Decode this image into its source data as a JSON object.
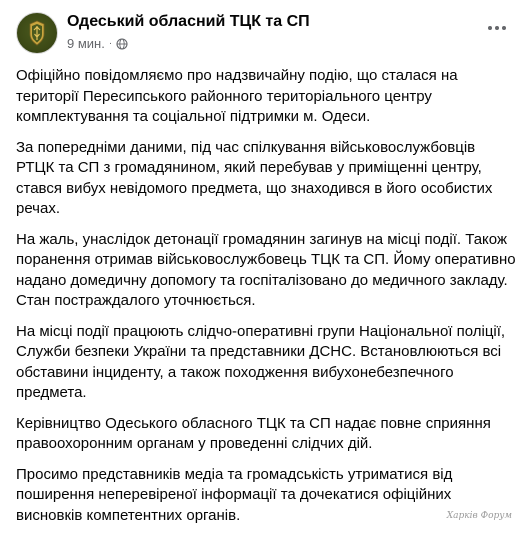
{
  "post": {
    "author": "Одеський обласний ТЦК та СП",
    "time": "9 мин.",
    "separator": "·",
    "audience_icon": "globe-icon",
    "more_icon": "more-horizontal-icon",
    "paragraphs": [
      "Офіційно повідомляємо про надзвичайну подію, що сталася на території Пересипського районного територіального центру комплектування та соціальної підтримки м. Одеси.",
      "За попередніми даними, під час спілкування військовослужбовців РТЦК та СП з громадянином, який перебував у приміщенні центру, стався вибух невідомого предмета, що знаходився в його особистих речах.",
      "На жаль, унаслідок детонації громадянин загинув на місці події. Також поранення отримав військовослужбовець ТЦК та СП. Йому оперативно надано домедичну допомогу та госпіталізовано до медичного закладу. Стан постраждалого уточнюється.",
      "На місці події працюють слідчо-оперативні групи Національної поліції, Служби безпеки України та представники ДСНС. Встановлюються всі обставини інциденту, а також походження вибухонебезпечного предмета.",
      "Керівництво Одеського обласного ТЦК та СП надає повне сприяння правоохоронним органам у проведенні слідчих дій.",
      "Просимо представників медіа та громадськість утриматися від поширення неперевіреної інформації та дочекатися офіційних висновків компетентних органів."
    ]
  },
  "watermark": "Харків Форум",
  "colors": {
    "text": "#050505",
    "secondary": "#65676b",
    "avatar_bg": "#3d4a16",
    "emblem_gold": "#d9b64a"
  }
}
